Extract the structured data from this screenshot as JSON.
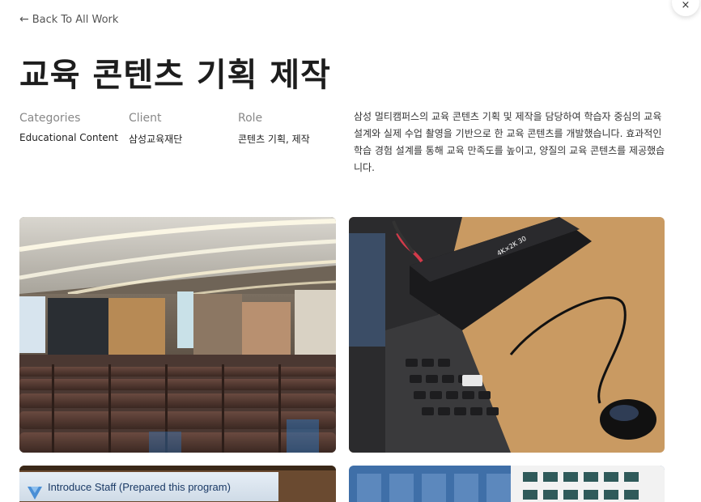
{
  "nav": {
    "back_label": "Back To All Work",
    "close_symbol": "×"
  },
  "project": {
    "title": "교육 콘텐츠 기획 제작",
    "meta": [
      {
        "label": "Categories",
        "value": "Educational Content"
      },
      {
        "label": "Client",
        "value": "삼성교육재단"
      },
      {
        "label": "Role",
        "value": "콘텐츠 기획, 제작"
      }
    ],
    "description": "삼성 멀티캠퍼스의 교육 콘텐츠 기획 및 제작을 담당하여 학습자 중심의 교육 설계와 실제 수업 촬영을 기반으로 한 교육 콘텐츠를 개발했습니다. 효과적인 학습 경험 설계를 통해 교육 만족도를 높이고, 양질의 교육 콘텐츠를 제공했습니다."
  },
  "gallery": {
    "slide_banner_text": "Introduce Staff (Prepared this program)",
    "device_label": "4K×2K 30"
  }
}
